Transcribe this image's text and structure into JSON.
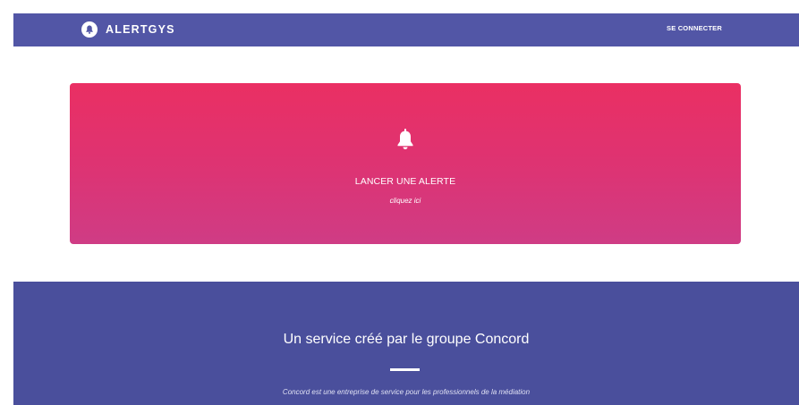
{
  "header": {
    "brand_name": "ALERTGYS",
    "login_label": "SE CONNECTER"
  },
  "alert": {
    "title": "LANCER UNE ALERTE",
    "subtitle": "cliquez ici",
    "icon": "bell-icon"
  },
  "footer": {
    "title": "Un service créé par le groupe Concord",
    "description": "Concord est une entreprise de service pour les professionnels de la médiation"
  },
  "colors": {
    "header_bg": "#5256a6",
    "alert_gradient_top": "#ea2f63",
    "alert_gradient_bottom": "#cf3c85",
    "footer_bg": "#4a4f9c"
  }
}
